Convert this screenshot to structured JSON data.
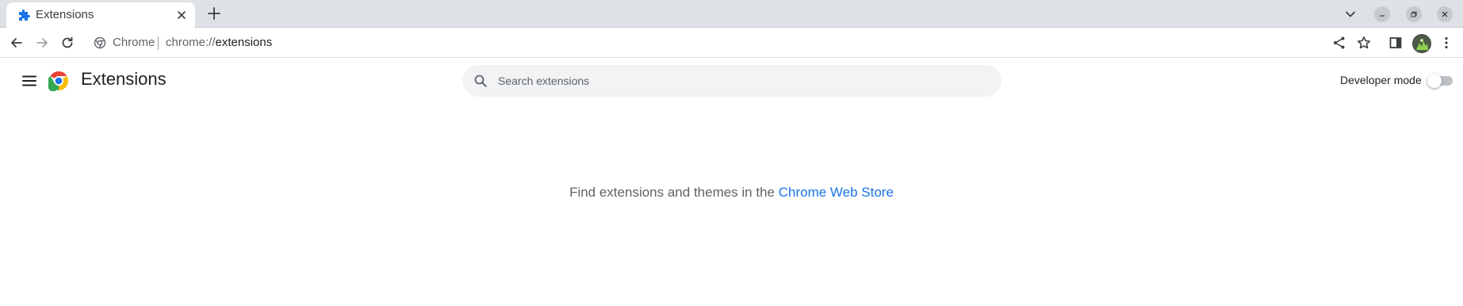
{
  "browser": {
    "tab": {
      "title": "Extensions"
    },
    "omnibox": {
      "chip_label": "Chrome",
      "url_scheme": "chrome://",
      "url_path": "extensions"
    }
  },
  "extensions_page": {
    "title": "Extensions",
    "search": {
      "placeholder": "Search extensions",
      "value": ""
    },
    "developer_mode": {
      "label": "Developer mode",
      "enabled": false
    },
    "empty_state": {
      "text": "Find extensions and themes in the ",
      "link_text": "Chrome Web Store"
    }
  },
  "colors": {
    "accent": "#1a73e8",
    "tabstrip": "#dee1e6",
    "search_bg": "#f1f3f4"
  },
  "icons": [
    "puzzle-icon",
    "close-icon",
    "plus-icon",
    "chevron-down-icon",
    "minimize-icon",
    "restore-icon",
    "back-icon",
    "forward-icon",
    "reload-icon",
    "chrome-site-icon",
    "share-icon",
    "star-icon",
    "side-panel-icon",
    "menu-icon",
    "hamburger-icon",
    "search-icon"
  ]
}
